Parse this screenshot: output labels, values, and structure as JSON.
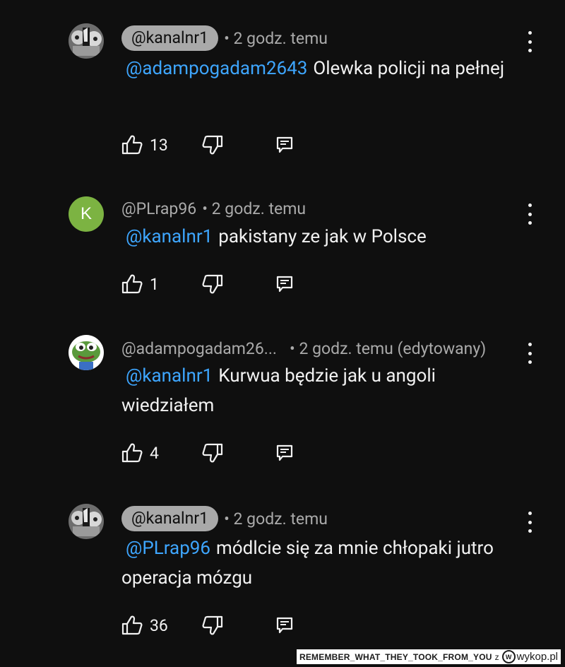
{
  "comments": [
    {
      "author": "@kanalnr1",
      "author_style": "chip",
      "time": "• 2 godz. temu",
      "mention": "@adampogadam2643",
      "text": "Olewka policji na pełnej",
      "likes": "13",
      "avatar": "skull-avatar"
    },
    {
      "author": "@PLrap96",
      "author_style": "plain",
      "avatar_letter": "K",
      "avatar_color": "#7cb342",
      "time": "• 2 godz. temu",
      "mention": "@kanalnr1",
      "text": "pakistany ze jak w Polsce",
      "likes": "1"
    },
    {
      "author": "@adampogadam26...",
      "author_style": "plain",
      "time": "• 2 godz. temu (edytowany)",
      "mention": "@kanalnr1",
      "text": "Kurwua będzie jak u angoli wiedziałem",
      "likes": "4",
      "avatar": "frog-avatar"
    },
    {
      "author": "@kanalnr1",
      "author_style": "chip",
      "time": "• 2 godz. temu",
      "mention": "@PLrap96",
      "text": "módlcie się za mnie chłopaki jutro operacja mózgu",
      "likes": "36",
      "avatar": "skull-avatar"
    }
  ],
  "footer": {
    "watermark": "REMEMBER_WHAT_THEY_TOOK_FROM_YOU",
    "z": "z",
    "site": "wykop.pl"
  },
  "colors": {
    "background": "#0f0f0f",
    "mention": "#3ea6ff",
    "meta": "#aaaaaa",
    "chip": "#a9a9a9"
  }
}
